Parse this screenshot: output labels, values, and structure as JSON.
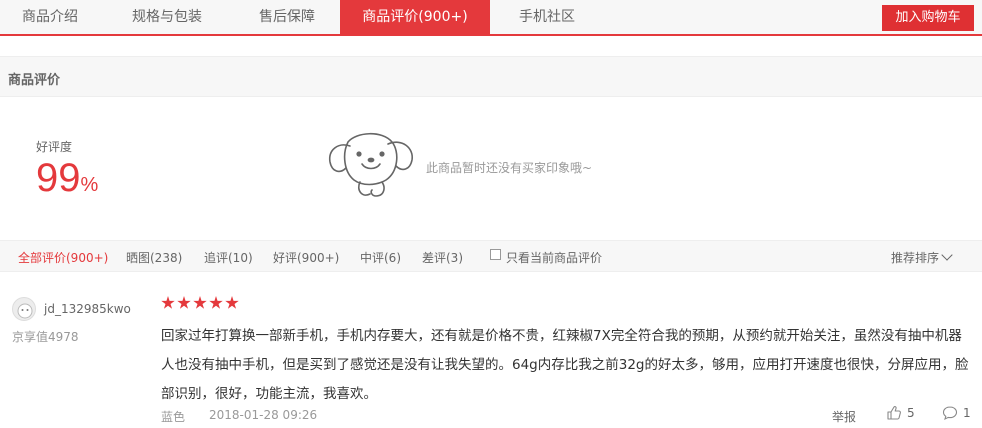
{
  "tabs": [
    {
      "label": "商品介绍",
      "active": false
    },
    {
      "label": "规格与包装",
      "active": false
    },
    {
      "label": "售后保障",
      "active": false
    },
    {
      "label": "商品评价(900+)",
      "active": true
    },
    {
      "label": "手机社区",
      "active": false
    }
  ],
  "cart_button": "加入购物车",
  "section_title": "商品评价",
  "rate": {
    "label": "好评度",
    "value": "99",
    "unit": "%"
  },
  "empty_impression": "此商品暂时还没有买家印象哦~",
  "filters": [
    {
      "label": "全部评价(900+)",
      "active": true
    },
    {
      "label": "晒图(238)",
      "active": false
    },
    {
      "label": "追评(10)",
      "active": false
    },
    {
      "label": "好评(900+)",
      "active": false
    },
    {
      "label": "中评(6)",
      "active": false
    },
    {
      "label": "差评(3)",
      "active": false
    }
  ],
  "only_current_label": "只看当前商品评价",
  "sort_label": "推荐排序",
  "review": {
    "username": "jd_132985kwo",
    "user_level": "京享值4978",
    "stars": 5,
    "text": "回家过年打算换一部新手机，手机内存要大，还有就是价格不贵，红辣椒7X完全符合我的预期，从预约就开始关注，虽然没有抽中机器人也没有抽中手机，但是买到了感觉还是没有让我失望的。64g内存比我之前32g的好太多，够用，应用打开速度也很快，分屏应用，脸部识别，很好，功能主流，我喜欢。",
    "color": "蓝色",
    "date": "2018-01-28 09:26",
    "report_label": "举报",
    "likes": "5",
    "replies": "1"
  },
  "colors": {
    "accent": "#e4393c"
  }
}
